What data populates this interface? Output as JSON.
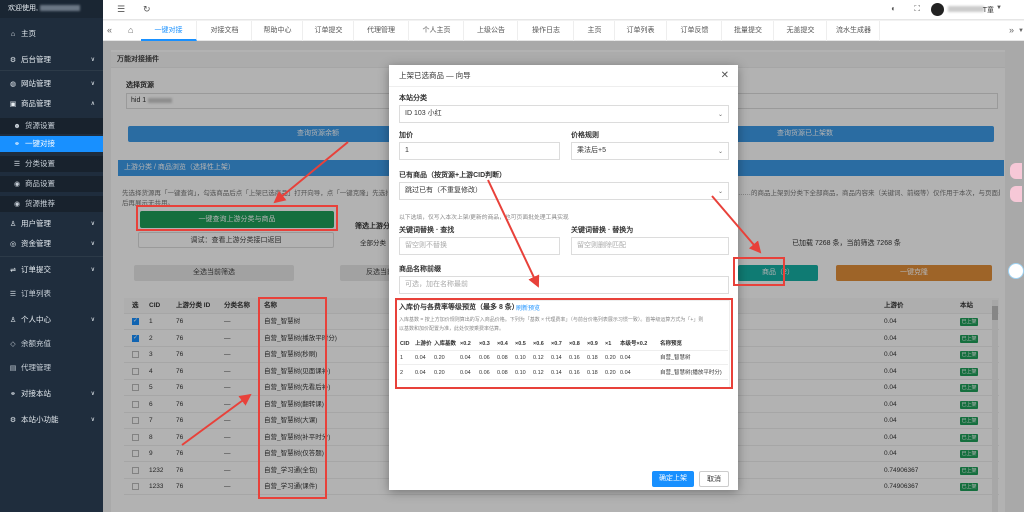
{
  "sidebar": {
    "welcome": "欢迎使用,",
    "items": [
      {
        "label": "主页",
        "icon": "home-icon"
      },
      {
        "label": "后台管理",
        "icon": "gear-icon"
      },
      {
        "label": "网站管理",
        "icon": "globe-icon"
      },
      {
        "label": "商品管理",
        "icon": "box-icon"
      },
      {
        "label": "货源设置",
        "icon": "people-icon"
      },
      {
        "label": "一键对接",
        "icon": "link-icon"
      },
      {
        "label": "分类设置",
        "icon": "list-icon"
      },
      {
        "label": "商品设置",
        "icon": "dot-icon"
      },
      {
        "label": "货源推荐",
        "icon": "dot-icon"
      },
      {
        "label": "用户管理",
        "icon": "user-icon"
      },
      {
        "label": "资金管理",
        "icon": "coin-icon"
      },
      {
        "label": "订单提交",
        "icon": "cart-icon"
      },
      {
        "label": "订单列表",
        "icon": "list-icon"
      },
      {
        "label": "个人中心",
        "icon": "user-icon"
      },
      {
        "label": "余额充值",
        "icon": "wallet-icon"
      },
      {
        "label": "代理管理",
        "icon": "doc-icon"
      },
      {
        "label": "对接本站",
        "icon": "link-icon"
      },
      {
        "label": "本站小功能",
        "icon": "gear-icon"
      }
    ]
  },
  "topbar": {
    "username": "T童"
  },
  "tabs": [
    "一键对接",
    "对接文档",
    "帮助中心",
    "订单提交",
    "代理管理",
    "个人主页",
    "上级公告",
    "操作日志",
    "主页",
    "订单列表",
    "订单反馈",
    "批量提交",
    "无盖提交",
    "流水生成器"
  ],
  "main": {
    "panel_title": "万能对接插件",
    "source_label": "选择货源",
    "source_value": "hid 1",
    "query_btn": "查询货源余额",
    "query_btn2": "查询货源已上架数",
    "info_title": "上游分类 / 商品浏览（选择性上架）",
    "info_note": "先选择货源再「一键查询」，勾选商品后点「上架已选商品」打开向导，点「一键克隆」先选择整个……",
    "info_note_right": "……的商品上架到分类下全部商品，商品内容来（关键词、前缀等）仅作用于本次，与页面最新曲线工具",
    "info_note2": "后再展示无共用。",
    "query_up_btn": "一键查询上游分类与商品",
    "test_btn": "调试：查看上游分类接口返回",
    "filter_label": "筛选上游分",
    "filter_all": "全部分类",
    "select_current": "全选当前筛选",
    "invert_current": "反选当前",
    "upload_selected": "商品（2）",
    "one_clone": "一键克隆",
    "loaded_count": "已加载 7268 条，当前筛选 7268 条"
  },
  "table": {
    "headers": [
      "选",
      "CID",
      "上游分类 ID",
      "分类名称",
      "名称",
      "上游价",
      "本站"
    ],
    "rows": [
      {
        "checked": true,
        "cid": "1",
        "up": "76",
        "cat": "—",
        "name": "自营_智慧树",
        "price": "0.04",
        "status": "已上架"
      },
      {
        "checked": true,
        "cid": "2",
        "up": "76",
        "cat": "—",
        "name": "自营_智慧树(播放平时分)",
        "price": "0.04",
        "status": "已上架"
      },
      {
        "checked": false,
        "cid": "3",
        "up": "76",
        "cat": "—",
        "name": "自营_智慧树(秒刷)",
        "price": "0.04",
        "status": "已上架"
      },
      {
        "checked": false,
        "cid": "4",
        "up": "76",
        "cat": "—",
        "name": "自营_智慧树(见面课补)",
        "price": "0.04",
        "status": "已上架"
      },
      {
        "checked": false,
        "cid": "5",
        "up": "76",
        "cat": "—",
        "name": "自营_智慧树(先看后补)",
        "price": "0.04",
        "status": "已上架"
      },
      {
        "checked": false,
        "cid": "6",
        "up": "76",
        "cat": "—",
        "name": "自营_智慧树(翻转课)",
        "price": "0.04",
        "status": "已上架"
      },
      {
        "checked": false,
        "cid": "7",
        "up": "76",
        "cat": "—",
        "name": "自营_智慧树(大课)",
        "price": "0.04",
        "status": "已上架"
      },
      {
        "checked": false,
        "cid": "8",
        "up": "76",
        "cat": "—",
        "name": "自营_智慧树(补平时分)",
        "price": "0.04",
        "status": "已上架"
      },
      {
        "checked": false,
        "cid": "9",
        "up": "76",
        "cat": "—",
        "name": "自营_智慧树(仅答题)",
        "price": "0.04",
        "status": "已上架"
      },
      {
        "checked": false,
        "cid": "1232",
        "up": "76",
        "cat": "—",
        "name": "自营_学习通(全包)",
        "price": "0.74906367",
        "status": "已上架"
      },
      {
        "checked": false,
        "cid": "1233",
        "up": "76",
        "cat": "—",
        "name": "自营_学习通(课件)",
        "price": "0.74906367",
        "status": "已上架"
      }
    ]
  },
  "modal": {
    "title": "上架已选商品 — 向导",
    "category_label": "本站分类",
    "category_value": "ID 103 小红",
    "markup_label": "加价",
    "markup_value": "1",
    "price_rule_label": "价格规则",
    "price_rule_value": "乘法后+5",
    "existing_label": "已有商品（按货源+上游CID判断）",
    "existing_value": "跳过已有（不重复修改）",
    "below_note": "以下选填，仅写入本次上架/更新的商品，也可页面批处理工具实现",
    "kw_find_label": "关键词替换 · 查找",
    "kw_find_ph": "留空则不替换",
    "kw_replace_label": "关键词替换 · 替换为",
    "kw_replace_ph": "留空则删除匹配",
    "prefix_label": "商品名称前缀",
    "prefix_ph": "可选，加在名称最前",
    "preview_title": "入库价与各费率等级预览（最多 8 条）",
    "preview_refresh": "刷新预览",
    "preview_note1": "入库基数 = 按上方加价规则算出的写入商品价格。下列为「基数 × 代理费率」（与前台价格列表展示习惯一致）。首等级运算方式为「+」则",
    "preview_note2": "以基数和加价配置为准，此处仅按乘费率估算。",
    "preview_headers": [
      "CID",
      "上游价",
      "入库基数",
      "×0.2",
      "×0.3",
      "×0.4",
      "×0.5",
      "×0.6",
      "×0.7",
      "×0.8",
      "×0.9",
      "×1",
      "本级号×0.2",
      "名称预览"
    ],
    "preview_rows": [
      [
        "1",
        "0.04",
        "0.20",
        "0.04",
        "0.06",
        "0.08",
        "0.10",
        "0.12",
        "0.14",
        "0.16",
        "0.18",
        "0.20",
        "0.04",
        "自营_智慧树"
      ],
      [
        "2",
        "0.04",
        "0.20",
        "0.04",
        "0.06",
        "0.08",
        "0.10",
        "0.12",
        "0.14",
        "0.16",
        "0.18",
        "0.20",
        "0.04",
        "自营_智慧树(播放平时分)"
      ]
    ],
    "confirm_btn": "确定上架",
    "cancel_btn": "取消"
  },
  "colors": {
    "sidebar_bg": "#1f2d3d",
    "accent": "#1890ff",
    "annotation_red": "#e8413a",
    "green": "#1fa05a",
    "orange": "#e3903a"
  }
}
